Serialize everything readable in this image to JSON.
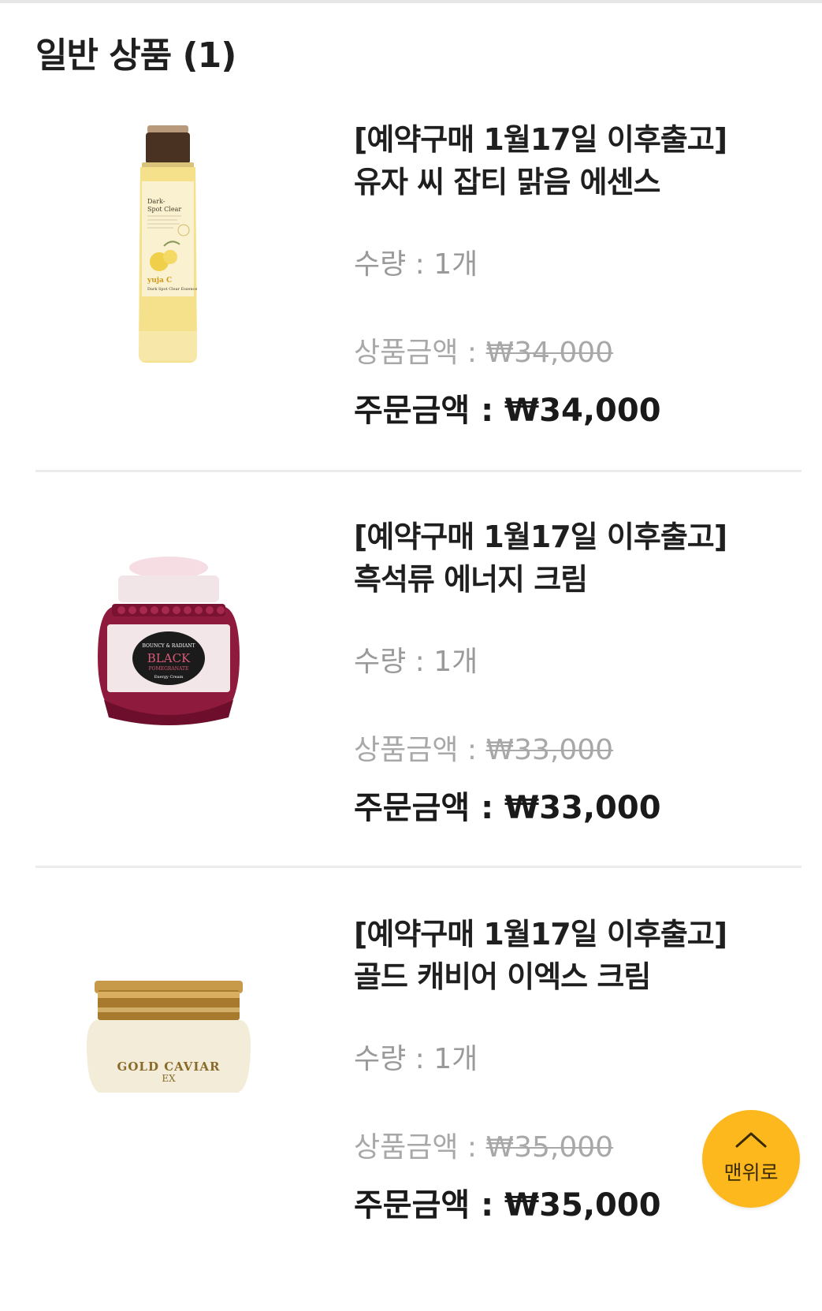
{
  "section": {
    "title": "일반 상품 (1)"
  },
  "products": [
    {
      "name_line1": "[예약구매 1월17일 이후출고]",
      "name_line2": "유자 씨 잡티 맑음 에센스",
      "qty_label": "수량 : 1개",
      "list_price_label": "상품금액 : ",
      "list_price": "₩34,000",
      "order_price_label": "주문금액 : ₩34,000",
      "image_icon": "yuja-essence-bottle-image",
      "image_text": [
        "Dark-",
        "Spot Clear",
        "yuja C",
        "Dark Spot Clear Essence"
      ]
    },
    {
      "name_line1": "[예약구매 1월17일 이후출고]",
      "name_line2": "흑석류 에너지 크림",
      "qty_label": "수량 : 1개",
      "list_price_label": "상품금액 : ",
      "list_price": "₩33,000",
      "order_price_label": "주문금액 : ₩33,000",
      "image_icon": "black-pomegranate-cream-jar-image",
      "image_text": [
        "BOUNCY & RADIANT",
        "BLACK",
        "POMEGRANATE",
        "Energy Cream"
      ]
    },
    {
      "name_line1": "[예약구매 1월17일 이후출고]",
      "name_line2": "골드 캐비어 이엑스 크림",
      "qty_label": "수량 : 1개",
      "list_price_label": "상품금액 : ",
      "list_price": "₩35,000",
      "order_price_label": "주문금액 : ₩35,000",
      "image_icon": "gold-caviar-cream-jar-image",
      "image_text": [
        "GOLD CAVIAR",
        "EX"
      ]
    }
  ],
  "scroll_top": {
    "label": "맨위로",
    "icon": "chevron-up-icon"
  },
  "colors": {
    "title": "#1f1f1f",
    "muted": "#9a9a9a",
    "divider": "#ececec",
    "top_button": "#fdb81e"
  }
}
